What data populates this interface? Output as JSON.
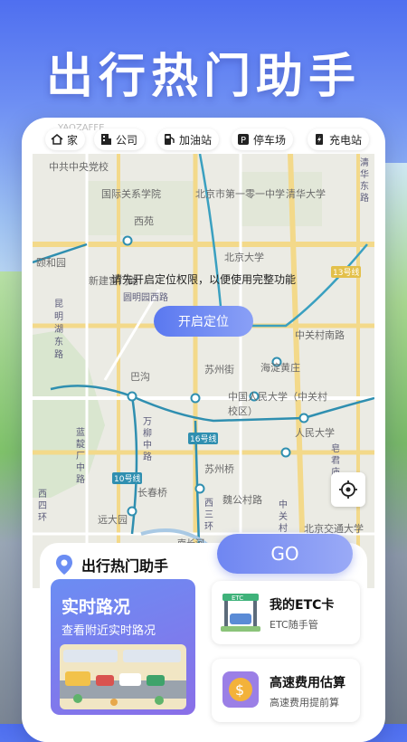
{
  "hero": {
    "title": "出行热门助手"
  },
  "watermark": "YAOZAFFE",
  "categories": [
    {
      "label": "家",
      "icon": "home-icon"
    },
    {
      "label": "公司",
      "icon": "building-icon"
    },
    {
      "label": "加油站",
      "icon": "gas-station-icon"
    },
    {
      "label": "停车场",
      "icon": "parking-icon"
    },
    {
      "label": "充电站",
      "icon": "charging-station-icon"
    }
  ],
  "map": {
    "notice": "请先开启定位权限，以便使用完整功能",
    "locate_label": "开启定位",
    "labels": [
      "中共中央党校",
      "国际关系学院",
      "北京市第一零一中学",
      "清华大学",
      "西苑",
      "颐和园",
      "新建宫门路",
      "北京大学",
      "昆明湖东路",
      "中关村南路",
      "巴沟",
      "苏州街",
      "海淀黄庄",
      "中国人民大学（中关村校区）",
      "人民大学",
      "苏州桥",
      "长春桥",
      "远大园",
      "魏公村路",
      "北京交通大学",
      "蓝靛厂中路",
      "西四环",
      "西三环",
      "万柳中路",
      "南长河",
      "16号线",
      "10号线",
      "13号线",
      "圆明园西路",
      "中关村大街",
      "皂君庙路",
      "清华东路"
    ]
  },
  "bottom": {
    "brand": "出行热门助手",
    "go_label": "GO",
    "realtime": {
      "title": "实时路况",
      "subtitle": "查看附近实时路况"
    },
    "etc": {
      "title": "我的ETC卡",
      "subtitle": "ETC随手管"
    },
    "fee": {
      "title": "高速费用估算",
      "subtitle": "高速费用提前算"
    }
  },
  "colors": {
    "primary": "#6b86f2",
    "accent_purple": "#8a6fe8",
    "metro": "#2f8fb0"
  }
}
